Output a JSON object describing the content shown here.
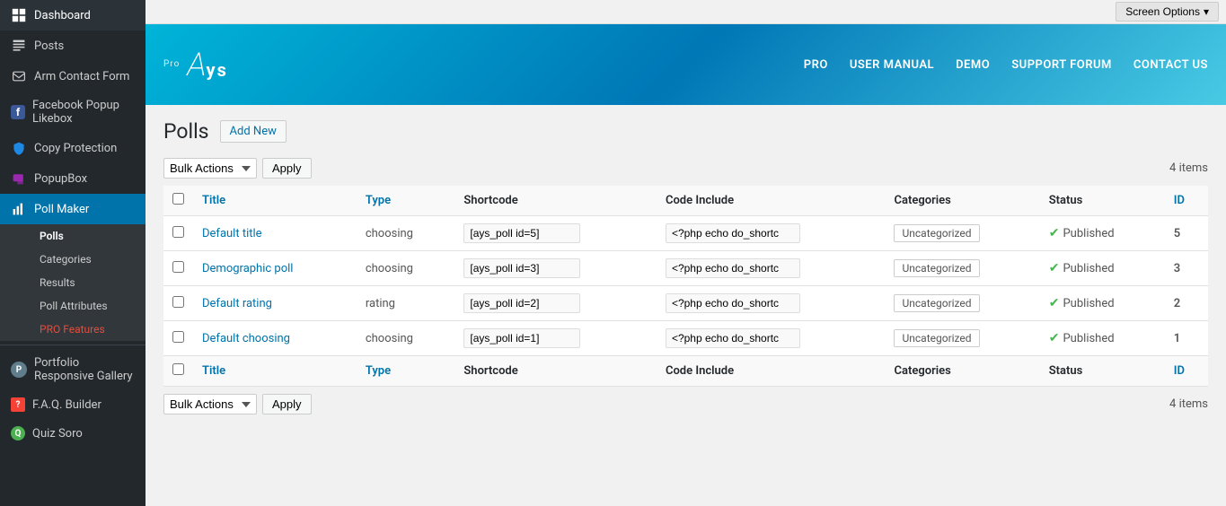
{
  "sidebar": {
    "items": [
      {
        "id": "dashboard",
        "label": "Dashboard",
        "icon": "dashboard"
      },
      {
        "id": "posts",
        "label": "Posts",
        "icon": "posts"
      },
      {
        "id": "arm-contact-form",
        "label": "Arm Contact Form",
        "icon": "contact"
      },
      {
        "id": "facebook-popup-likebox",
        "label": "Facebook Popup Likebox",
        "icon": "facebook"
      },
      {
        "id": "copy-protection",
        "label": "Copy Protection",
        "icon": "shield"
      },
      {
        "id": "popupbox",
        "label": "PopupBox",
        "icon": "popup"
      },
      {
        "id": "poll-maker",
        "label": "Poll Maker",
        "icon": "chart",
        "active": true
      }
    ],
    "submenu": [
      {
        "id": "polls",
        "label": "Polls",
        "active": true
      },
      {
        "id": "categories",
        "label": "Categories"
      },
      {
        "id": "results",
        "label": "Results"
      },
      {
        "id": "poll-attributes",
        "label": "Poll Attributes"
      },
      {
        "id": "pro-features",
        "label": "PRO Features",
        "class": "pro-features"
      }
    ],
    "bottom_items": [
      {
        "id": "portfolio-responsive-gallery",
        "label": "Portfolio Responsive Gallery",
        "icon": "gallery"
      },
      {
        "id": "faq-builder",
        "label": "F.A.Q. Builder",
        "icon": "faq"
      },
      {
        "id": "quiz-soro",
        "label": "Quiz Soro",
        "icon": "quiz"
      }
    ]
  },
  "banner": {
    "logo_letter": "A",
    "logo_ys": "ys",
    "logo_pro": "Pro",
    "nav_items": [
      {
        "id": "pro",
        "label": "PRO"
      },
      {
        "id": "user-manual",
        "label": "USER MANUAL"
      },
      {
        "id": "demo",
        "label": "DEMO"
      },
      {
        "id": "support-forum",
        "label": "SUPPORT FORUM"
      },
      {
        "id": "contact-us",
        "label": "CONTACT US"
      }
    ]
  },
  "screen_options": {
    "label": "Screen Options",
    "arrow": "▾"
  },
  "page": {
    "title": "Polls",
    "add_new_label": "Add New"
  },
  "toolbar_top": {
    "bulk_actions_label": "Bulk Actions",
    "apply_label": "Apply",
    "items_count": "4 items"
  },
  "toolbar_bottom": {
    "bulk_actions_label": "Bulk Actions",
    "apply_label": "Apply",
    "items_count": "4 items"
  },
  "table": {
    "columns": [
      {
        "id": "title",
        "label": "Title",
        "sortable": true
      },
      {
        "id": "type",
        "label": "Type",
        "sortable": true
      },
      {
        "id": "shortcode",
        "label": "Shortcode",
        "sortable": false
      },
      {
        "id": "code-include",
        "label": "Code Include",
        "sortable": false
      },
      {
        "id": "categories",
        "label": "Categories",
        "sortable": false
      },
      {
        "id": "status",
        "label": "Status",
        "sortable": false
      },
      {
        "id": "id",
        "label": "ID",
        "sortable": true
      }
    ],
    "rows": [
      {
        "title": "Default title",
        "type": "choosing",
        "shortcode": "[ays_poll id=5]",
        "code_include": "<?php echo do_shortc",
        "category": "Uncategorized",
        "status": "Published",
        "id": "5"
      },
      {
        "title": "Demographic poll",
        "type": "choosing",
        "shortcode": "[ays_poll id=3]",
        "code_include": "<?php echo do_shortc",
        "category": "Uncategorized",
        "status": "Published",
        "id": "3"
      },
      {
        "title": "Default rating",
        "type": "rating",
        "shortcode": "[ays_poll id=2]",
        "code_include": "<?php echo do_shortc",
        "category": "Uncategorized",
        "status": "Published",
        "id": "2"
      },
      {
        "title": "Default choosing",
        "type": "choosing",
        "shortcode": "[ays_poll id=1]",
        "code_include": "<?php echo do_shortc",
        "category": "Uncategorized",
        "status": "Published",
        "id": "1"
      }
    ]
  }
}
